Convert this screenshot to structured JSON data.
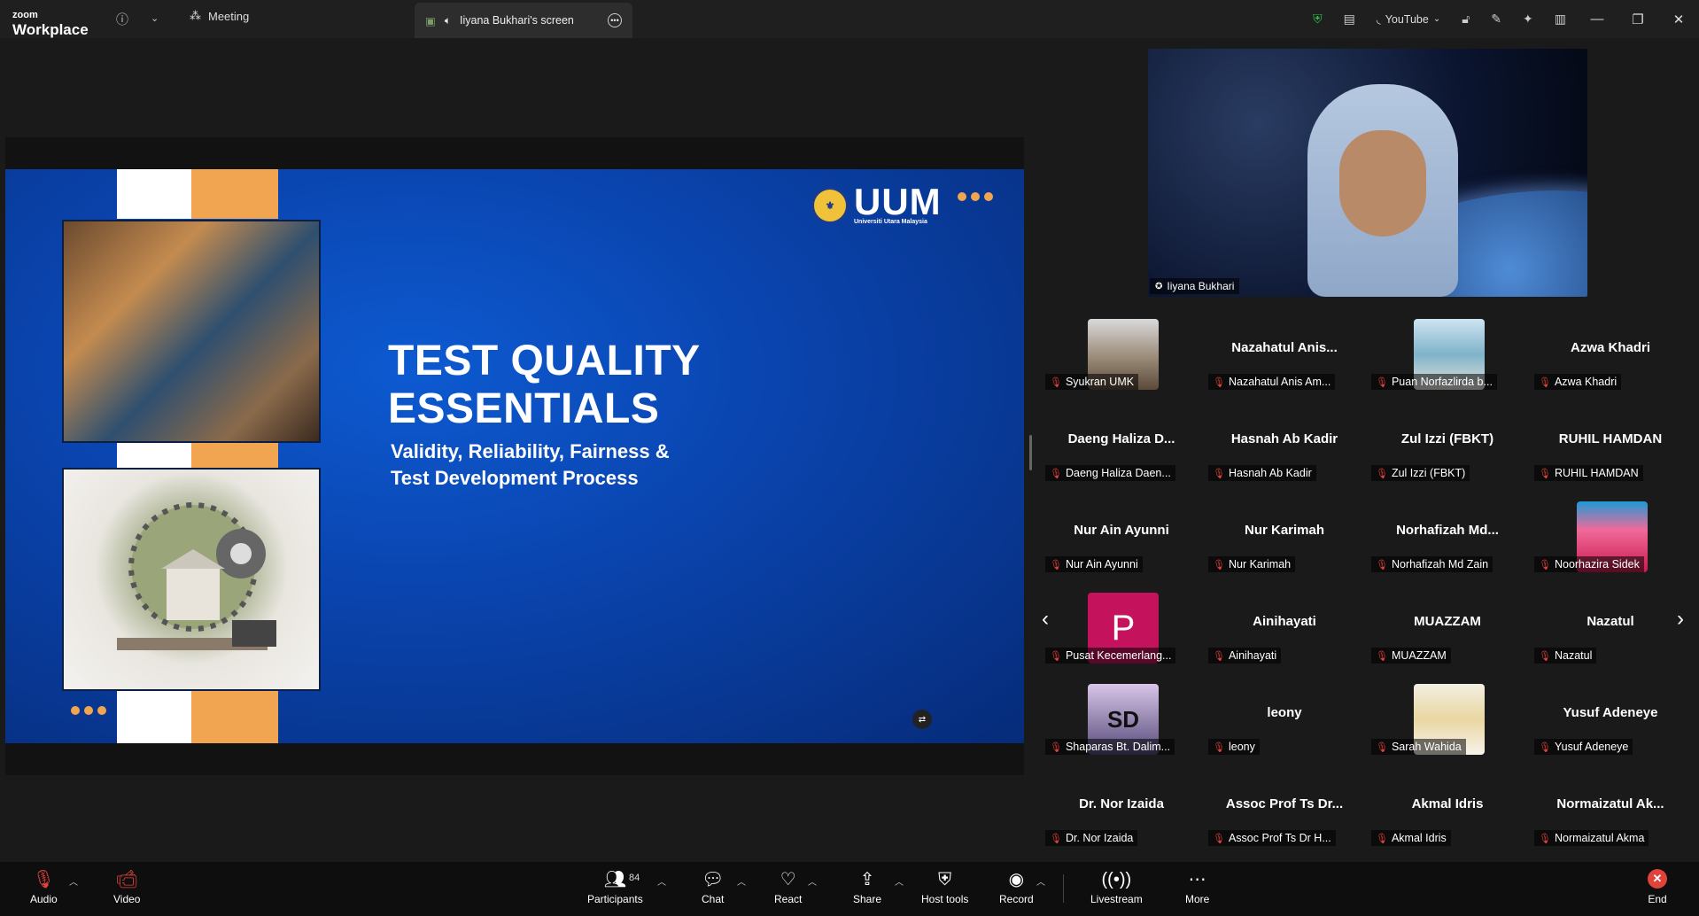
{
  "topbar": {
    "logo_small": "zoom",
    "logo_big": "Workplace",
    "meeting_label": "Meeting",
    "share_tab_label": "Iiyana Bukhari's screen",
    "youtube_label": "YouTube"
  },
  "slide": {
    "brand": "UUM",
    "brand_sub": "Universiti Utara Malaysia",
    "title_line1": "TEST QUALITY",
    "title_line2": "ESSENTIALS",
    "subtitle_line1": "Validity, Reliability, Fairness &",
    "subtitle_line2": "Test Development Process"
  },
  "speaker": {
    "name": "Iiyana Bukhari"
  },
  "participants": [
    {
      "big": "",
      "label": "Syukran UMK",
      "avatar": "photo1"
    },
    {
      "big": "Nazahatul Anis...",
      "label": "Nazahatul Anis Am...",
      "avatar": ""
    },
    {
      "big": "",
      "label": "Puan Norfazlirda b...",
      "avatar": "photo2"
    },
    {
      "big": "Azwa Khadri",
      "label": "Azwa Khadri",
      "avatar": ""
    },
    {
      "big": "Daeng Haliza D...",
      "label": "Daeng Haliza Daen...",
      "avatar": ""
    },
    {
      "big": "Hasnah Ab Kadir",
      "label": "Hasnah Ab Kadir",
      "avatar": ""
    },
    {
      "big": "Zul Izzi (FBKT)",
      "label": "Zul Izzi (FBKT)",
      "avatar": ""
    },
    {
      "big": "RUHIL HAMDAN",
      "label": "RUHIL HAMDAN",
      "avatar": ""
    },
    {
      "big": "Nur Ain Ayunni",
      "label": "Nur Ain Ayunni",
      "avatar": ""
    },
    {
      "big": "Nur Karimah",
      "label": "Nur Karimah",
      "avatar": ""
    },
    {
      "big": "Norhafizah Md...",
      "label": "Norhafizah Md Zain",
      "avatar": ""
    },
    {
      "big": "",
      "label": "Noorhazira Sidek",
      "avatar": "photo3"
    },
    {
      "big": "",
      "label": "Pusat Kecemerlang...",
      "avatar": "p",
      "avatar_letter": "P"
    },
    {
      "big": "Ainihayati",
      "label": "Ainihayati",
      "avatar": ""
    },
    {
      "big": "MUAZZAM",
      "label": "MUAZZAM",
      "avatar": ""
    },
    {
      "big": "Nazatul",
      "label": "Nazatul",
      "avatar": ""
    },
    {
      "big": "",
      "label": "Shaparas Bt. Dalim...",
      "avatar": "photo4",
      "avatar_letter": "SD"
    },
    {
      "big": "leony",
      "label": "leony",
      "avatar": ""
    },
    {
      "big": "",
      "label": "Sarah Wahida",
      "avatar": "photo5"
    },
    {
      "big": "Yusuf Adeneye",
      "label": "Yusuf Adeneye",
      "avatar": ""
    },
    {
      "big": "Dr. Nor Izaida",
      "label": "Dr. Nor Izaida",
      "avatar": ""
    },
    {
      "big": "Assoc Prof Ts Dr...",
      "label": "Assoc Prof Ts Dr H...",
      "avatar": ""
    },
    {
      "big": "Akmal Idris",
      "label": "Akmal Idris",
      "avatar": ""
    },
    {
      "big": "Normaizatul Ak...",
      "label": "Normaizatul Akma",
      "avatar": ""
    }
  ],
  "toolbar": {
    "audio": "Audio",
    "video": "Video",
    "participants": "Participants",
    "participants_count": "84",
    "chat": "Chat",
    "react": "React",
    "share": "Share",
    "host_tools": "Host tools",
    "record": "Record",
    "livestream": "Livestream",
    "more": "More",
    "end": "End"
  }
}
